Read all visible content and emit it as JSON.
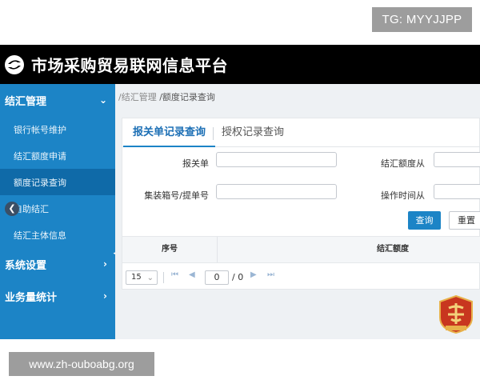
{
  "watermark_top": "TG: MYYJJPP",
  "watermark_bottom": "www.zh-ouboabg.org",
  "header": {
    "title": "市场采购贸易联网信息平台",
    "logo_icon": "platform-logo-icon"
  },
  "sidebar": {
    "group_fx": {
      "label": "结汇管理",
      "icon": "chevron-down-icon"
    },
    "items": [
      {
        "label": "银行帐号维护"
      },
      {
        "label": "结汇额度申请"
      },
      {
        "label": "额度记录查询"
      },
      {
        "label": "自助结汇"
      },
      {
        "label": "结汇主体信息"
      }
    ],
    "group_sys": {
      "label": "系统设置",
      "icon": "chevron-right-icon"
    },
    "group_stats": {
      "label": "业务量统计",
      "icon": "chevron-right-icon"
    },
    "accent_color": "#1c84c6",
    "active_color": "#0f6aa8"
  },
  "breadcrumb": {
    "part1": "/结汇管理",
    "part2": "/额度记录查询"
  },
  "tabs": [
    {
      "label": "报关单记录查询"
    },
    {
      "label": "授权记录查询"
    }
  ],
  "form": {
    "customs_label": "报关单",
    "customs_value": "",
    "container_label": "集装箱号/提单号",
    "container_value": "",
    "quota_from_label": "结汇额度从",
    "quota_from_value": "",
    "optime_from_label": "操作时间从",
    "optime_from_value": ""
  },
  "buttons": {
    "query": "查询",
    "reset": "重置"
  },
  "table": {
    "headers": [
      "序号",
      "结汇额度"
    ]
  },
  "pager": {
    "page_size": "15",
    "current_page": "0",
    "total": "/ 0"
  },
  "emblem_icon": "government-emblem-icon"
}
